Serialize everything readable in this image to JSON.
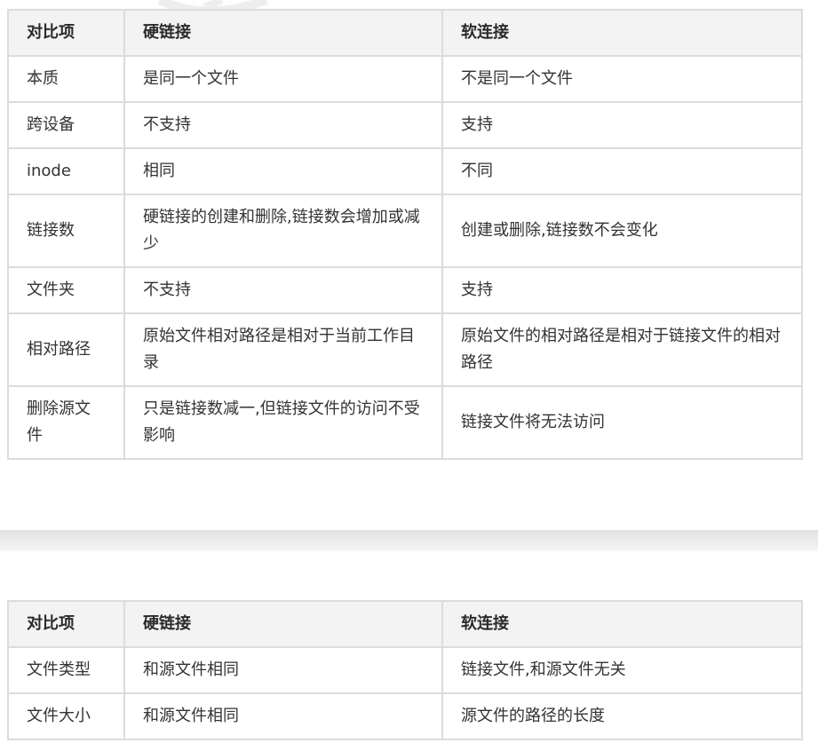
{
  "table_1": {
    "headers": [
      "对比项",
      "硬链接",
      "软连接"
    ],
    "rows": [
      [
        "本质",
        "是同一个文件",
        "不是同一个文件"
      ],
      [
        "跨设备",
        "不支持",
        "支持"
      ],
      [
        "inode",
        "相同",
        "不同"
      ],
      [
        "链接数",
        "硬链接的创建和删除,链接数会增加或减少",
        "创建或删除,链接数不会变化"
      ],
      [
        "文件夹",
        "不支持",
        "支持"
      ],
      [
        "相对路径",
        "原始文件相对路径是相对于当前工作目录",
        "原始文件的相对路径是相对于链接文件的相对路径"
      ],
      [
        "删除源文件",
        "只是链接数减一,但链接文件的访问不受影响",
        "链接文件将无法访问"
      ]
    ]
  },
  "table_2": {
    "headers": [
      "对比项",
      "硬链接",
      "软连接"
    ],
    "rows": [
      [
        "文件类型",
        "和源文件相同",
        "链接文件,和源文件无关"
      ],
      [
        "文件大小",
        "和源文件相同",
        "源文件的路径的长度"
      ]
    ]
  },
  "colors": {
    "border": "#dcdcdc",
    "header_bg": "#f3f3f3",
    "text": "#333333",
    "separator": "#e6e6e6"
  }
}
